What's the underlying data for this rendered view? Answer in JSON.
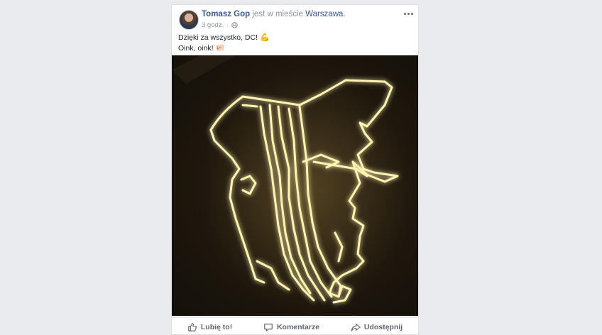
{
  "post": {
    "author": "Tomasz Gop",
    "checkin_prefix": "jest w mieście",
    "location": "Warszawa.",
    "time": "3 godz.",
    "separator": "·",
    "text_line_1": "Dzięki za wszystko, DC!",
    "emoji_1": "💪",
    "text_line_2": "Oink, oink!",
    "emoji_2": "🐖",
    "privacy_icon": "globe-icon",
    "more_icon": "more-options-icon"
  },
  "photo": {
    "description_icon": "neon-sign-photo",
    "neon_color": "#fff3b0",
    "glow_color": "#ffe27a"
  },
  "actions": {
    "like_label": "Lubię to!",
    "comment_label": "Komentarze",
    "share_label": "Udostępnij"
  },
  "colors": {
    "link": "#365899",
    "muted": "#90949c",
    "text": "#1d2129",
    "background": "#e9ebee"
  }
}
